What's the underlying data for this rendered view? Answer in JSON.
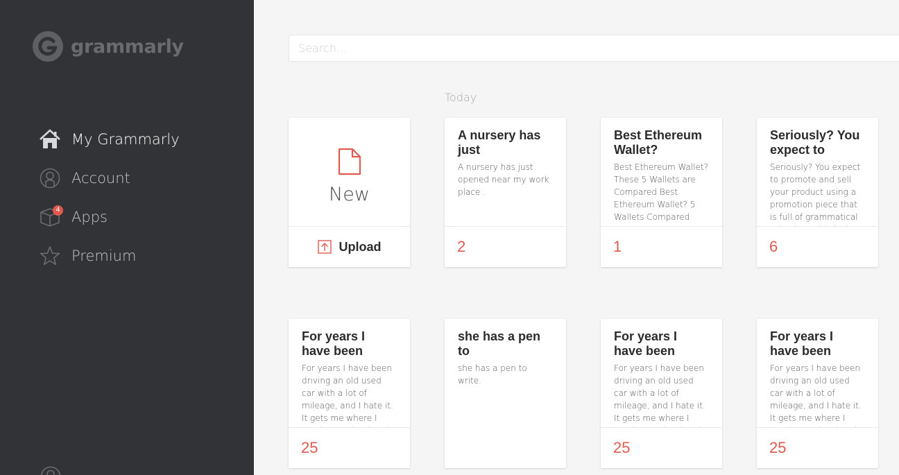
{
  "app": {
    "brand": "grammarly",
    "colors": {
      "sidebar": "#323336",
      "accent": "#e2594f",
      "background": "#f5f5f5"
    }
  },
  "nav": {
    "items": [
      {
        "label": "My Grammarly",
        "icon": "home-icon",
        "active": true
      },
      {
        "label": "Account",
        "icon": "account-icon"
      },
      {
        "label": "Apps",
        "icon": "apps-box-icon",
        "badge": "4"
      },
      {
        "label": "Premium",
        "icon": "star-icon"
      }
    ]
  },
  "search": {
    "placeholder": "Search..."
  },
  "section": {
    "label": "Today"
  },
  "new_card": {
    "label": "New",
    "upload_label": "Upload"
  },
  "documents": [
    {
      "title": "A nursery has just",
      "snippet": "A nursery has just opened near my work place .",
      "count": "2"
    },
    {
      "title": "Best Ethereum Wallet?",
      "snippet": "Best Ethereum Wallet? These 5 Wallets are Compared Best Ethereum Wallet? 5 Wallets Compared",
      "count": "1"
    },
    {
      "title": "Seriously? You expect to",
      "snippet": "Seriously? You expect to promote and sell your product using a promotion piece that is full of grammatical mistakes? This is the",
      "count": "6"
    },
    {
      "title": "For years I have been",
      "snippet": "For years I have been driving an old used car with a lot of mileage, and I hate it. It gets me where I need to go, but it's the kind of clunker that",
      "count": "25"
    },
    {
      "title": "she has a pen to",
      "snippet": "she has a pen to write.",
      "count": ""
    },
    {
      "title": "For years I have been",
      "snippet": "For years I have been driving an old used car with a lot of mileage, and I hate it. It gets me where I need to go, but it's the kind of clunker that",
      "count": "25"
    },
    {
      "title": "For years I have been",
      "snippet": "For years I have been driving an old used car with a lot of mileage, and I hate it. It gets me where I need to go, but it's the kind of clunker that",
      "count": "25"
    }
  ]
}
